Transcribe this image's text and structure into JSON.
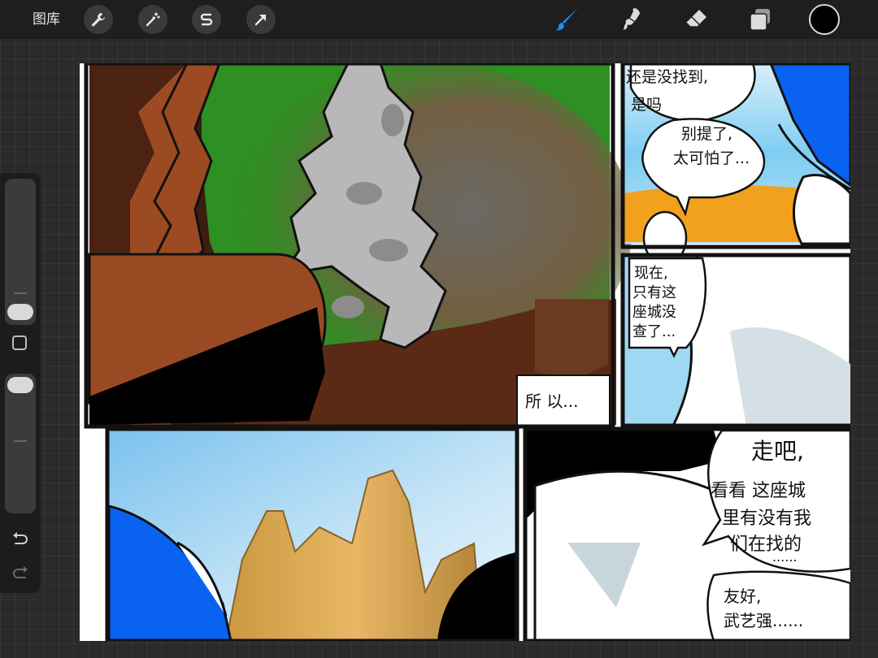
{
  "toolbar": {
    "gallery_label": "图库",
    "left_tools": [
      "wrench-icon",
      "magic-wand-icon",
      "selection-s-icon",
      "transform-arrow-icon"
    ],
    "right_tools": [
      "brush-icon",
      "smudge-icon",
      "eraser-icon",
      "layers-icon"
    ],
    "active_tool": "brush-icon",
    "accent_color": "#1e8ef5",
    "current_color": "#000000"
  },
  "sidebar": {
    "brush_size_level": 0.1,
    "opacity_level": 1.0,
    "buttons": [
      "modify-square-icon",
      "undo-icon",
      "redo-icon"
    ]
  },
  "comic": {
    "panel1_caption": "所 以...",
    "panel2_line1": "还是没找到,",
    "panel2_line2": "是吗",
    "panel2_reply1": "别提了,",
    "panel2_reply2": "太可怕了...",
    "panel3_line1": "现在,",
    "panel3_line2": "只有这",
    "panel3_line3": "座城没",
    "panel3_line4": "查了...",
    "panel5_line1": "走吧,",
    "panel5_line2": "看看 这座城",
    "panel5_line3": "里有没有我",
    "panel5_line4": "们在找的",
    "panel5_line5": "......",
    "panel5_small1": "友好,",
    "panel5_small2": "武艺强......"
  }
}
